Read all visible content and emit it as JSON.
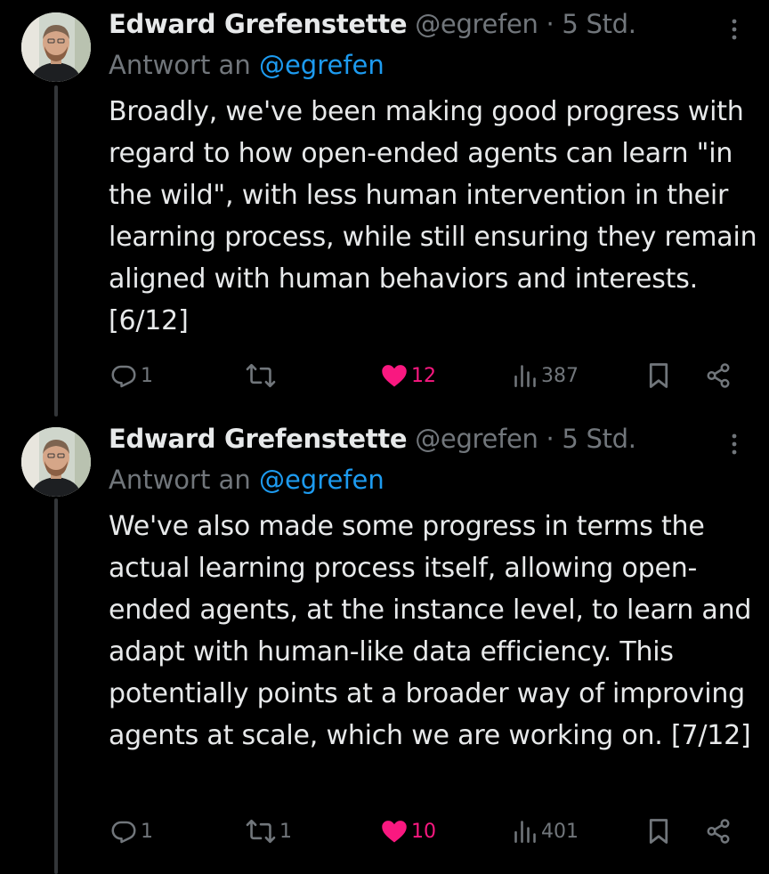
{
  "colors": {
    "background": "#000000",
    "text": "#e7e9ea",
    "muted": "#71767b",
    "link": "#1d9bf0",
    "like": "#f91880",
    "thread_line": "#333639"
  },
  "tweets": [
    {
      "author_name": "Edward Grefenstette",
      "handle": "@egrefen",
      "separator": "·",
      "time": "5 Std.",
      "reply_prefix": "Antwort an",
      "reply_handle": "@egrefen",
      "text": "Broadly, we've been making good progress with regard to how open-ended agents can learn \"in the wild\", with less human intervention in their learning process, while still ensuring they remain aligned with human behaviors and interests. [6/12]",
      "replies": "1",
      "reposts": "",
      "likes": "12",
      "views": "387",
      "liked": true,
      "icons": [
        "more-icon",
        "reply-icon",
        "repost-icon",
        "heart-icon",
        "views-icon",
        "bookmark-icon",
        "share-icon"
      ]
    },
    {
      "author_name": "Edward Grefenstette",
      "handle": "@egrefen",
      "separator": "·",
      "time": "5 Std.",
      "reply_prefix": "Antwort an",
      "reply_handle": "@egrefen",
      "text": "We've also made some progress in terms the actual learning process itself, allowing open-ended agents, at the instance level, to learn and adapt with human-like data efficiency. This potentially points at a broader way of improving agents at scale, which we are working on. [7/12]",
      "replies": "1",
      "reposts": "1",
      "likes": "10",
      "views": "401",
      "liked": true,
      "icons": [
        "more-icon",
        "reply-icon",
        "repost-icon",
        "heart-icon",
        "views-icon",
        "bookmark-icon",
        "share-icon"
      ]
    }
  ]
}
